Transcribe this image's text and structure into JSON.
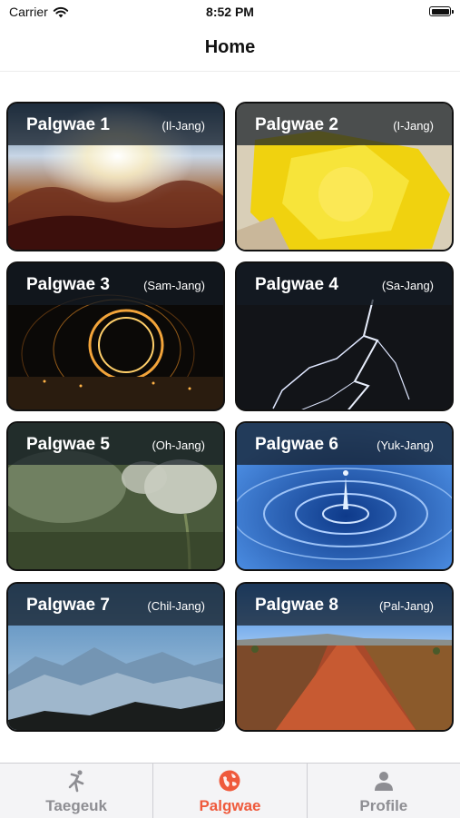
{
  "status_bar": {
    "carrier": "Carrier",
    "time": "8:52 PM"
  },
  "nav": {
    "title": "Home"
  },
  "cards": [
    {
      "name": "Palgwae 1",
      "subtitle": "(Il-Jang)"
    },
    {
      "name": "Palgwae 2",
      "subtitle": "(I-Jang)"
    },
    {
      "name": "Palgwae 3",
      "subtitle": "(Sam-Jang)"
    },
    {
      "name": "Palgwae 4",
      "subtitle": "(Sa-Jang)"
    },
    {
      "name": "Palgwae 5",
      "subtitle": "(Oh-Jang)"
    },
    {
      "name": "Palgwae 6",
      "subtitle": "(Yuk-Jang)"
    },
    {
      "name": "Palgwae 7",
      "subtitle": "(Chil-Jang)"
    },
    {
      "name": "Palgwae 8",
      "subtitle": "(Pal-Jang)"
    }
  ],
  "tabs": [
    {
      "label": "Taegeuk",
      "icon": "martial-arts-kick-icon",
      "active": false
    },
    {
      "label": "Palgwae",
      "icon": "globe-icon",
      "active": true
    },
    {
      "label": "Profile",
      "icon": "person-icon",
      "active": false
    }
  ],
  "colors": {
    "accent": "#ef5a3c",
    "inactive": "#8e8e93"
  }
}
